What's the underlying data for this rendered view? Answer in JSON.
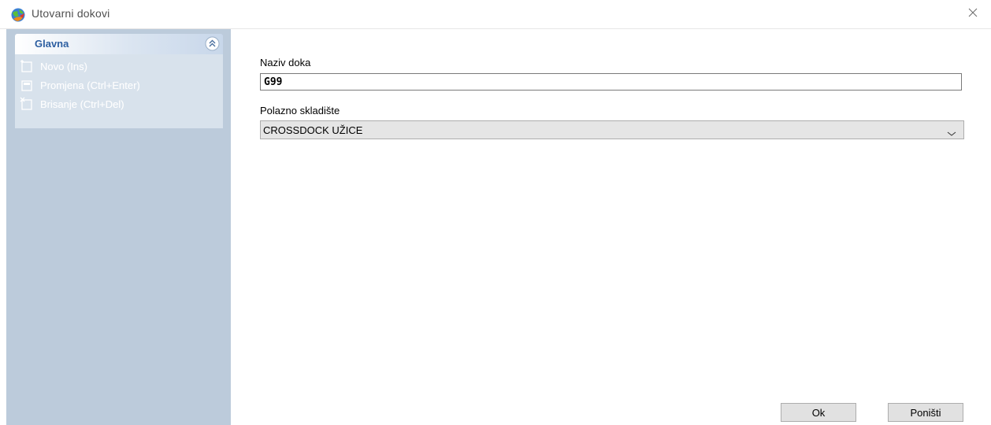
{
  "window": {
    "title": "Utovarni dokovi",
    "app_icon": "globe-app-icon",
    "close_icon": "close-icon"
  },
  "sidebar": {
    "group": {
      "title": "Glavna",
      "collapse_icon": "double-chevron-up-icon",
      "items": [
        {
          "label": "Novo (Ins)",
          "icon": "new-item-icon",
          "enabled": false
        },
        {
          "label": "Promjena (Ctrl+Enter)",
          "icon": "edit-item-icon",
          "enabled": false
        },
        {
          "label": "Brisanje (Ctrl+Del)",
          "icon": "delete-item-icon",
          "enabled": false
        }
      ]
    }
  },
  "form": {
    "dock_name": {
      "label": "Naziv doka",
      "value": "G99"
    },
    "warehouse": {
      "label": "Polazno skladište",
      "value": "CROSSDOCK UŽICE",
      "icon": "chevron-down-icon"
    }
  },
  "buttons": {
    "ok": "Ok",
    "cancel": "Poništi"
  },
  "colors": {
    "sidebar_bg": "#bccbdb",
    "group_title": "#2d5fa1"
  }
}
